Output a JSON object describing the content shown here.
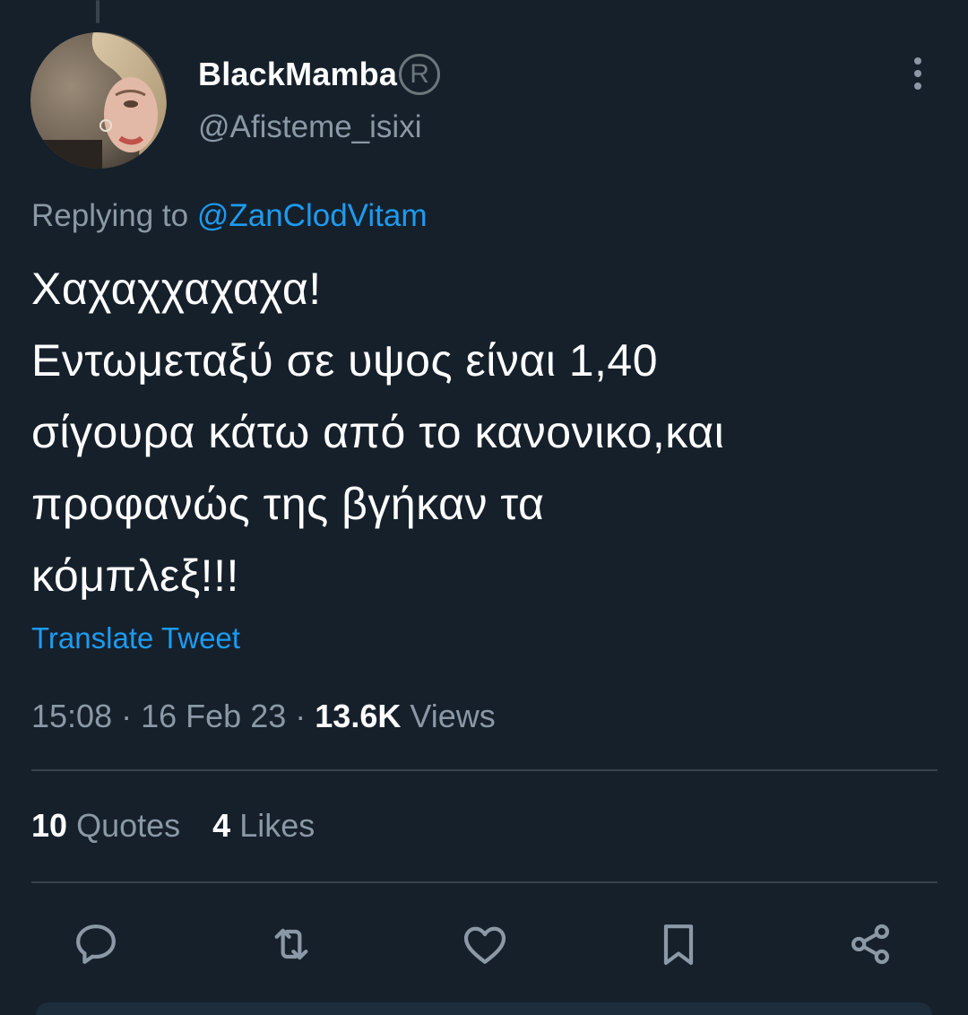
{
  "tweet": {
    "display_name": "BlackMamba",
    "badge": "R",
    "handle": "@Afisteme_isixi",
    "replying_prefix": "Replying to",
    "replying_to": "@ZanClodVitam",
    "text_lines": [
      "Χαχαχχαχαχα!",
      "Εντωμεταξύ σε υψος είναι 1,40",
      "σίγουρα κάτω από το κανονικο,και",
      "προφανώς της βγήκαν τα",
      "κόμπλεξ!!!"
    ],
    "translate_label": "Translate Tweet",
    "time": "15:08",
    "separator": "·",
    "date": "16 Feb 23",
    "views_count": "13.6K",
    "views_label": "Views",
    "quotes_count": "10",
    "quotes_label": "Quotes",
    "likes_count": "4",
    "likes_label": "Likes"
  },
  "actions": [
    {
      "name": "reply",
      "icon": "reply-icon"
    },
    {
      "name": "retweet",
      "icon": "retweet-icon"
    },
    {
      "name": "like",
      "icon": "heart-icon"
    },
    {
      "name": "bookmark",
      "icon": "bookmark-icon"
    },
    {
      "name": "share",
      "icon": "share-icon"
    }
  ],
  "colors": {
    "background": "#15202b",
    "text_primary": "#ffffff",
    "text_secondary": "#8b98a5",
    "accent": "#1d9bf0",
    "divider": "#38444d"
  }
}
